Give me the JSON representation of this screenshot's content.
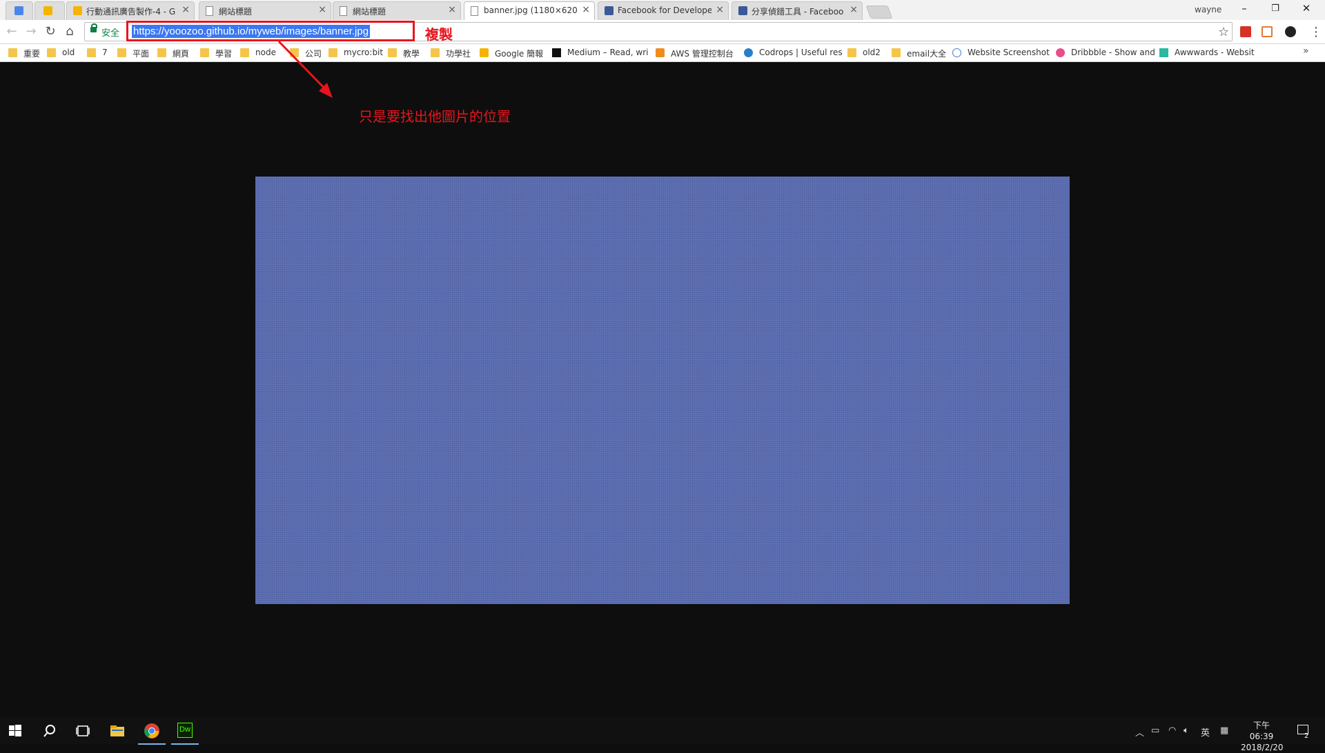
{
  "browser": {
    "tabs": [
      {
        "title": "",
        "icon": "google-docs-icon",
        "pinned": true
      },
      {
        "title": "",
        "icon": "google-slides-icon",
        "pinned": true
      },
      {
        "title": "行動通訊廣告製作-4 - G",
        "icon": "google-slides-icon"
      },
      {
        "title": "網站標題",
        "icon": "page-icon"
      },
      {
        "title": "網站標題",
        "icon": "page-icon"
      },
      {
        "title": "banner.jpg (1180×620)",
        "icon": "page-icon",
        "active": true
      },
      {
        "title": "Facebook for Develope",
        "icon": "facebook-icon"
      },
      {
        "title": "分享偵錯工具 - Faceboo",
        "icon": "facebook-icon"
      }
    ],
    "user": "wayne",
    "window_controls": {
      "minimize": "–",
      "restore": "❐",
      "close": "✕"
    },
    "secure_label": "安全",
    "url": "https://yooozoo.github.io/myweb/images/banner.jpg",
    "bookmarks": [
      {
        "label": "重要",
        "icon": "folder-icon"
      },
      {
        "label": "old",
        "icon": "folder-icon"
      },
      {
        "label": "7",
        "icon": "folder-icon"
      },
      {
        "label": "平面",
        "icon": "folder-icon"
      },
      {
        "label": "網頁",
        "icon": "folder-icon"
      },
      {
        "label": "學習",
        "icon": "folder-icon"
      },
      {
        "label": "node",
        "icon": "folder-icon"
      },
      {
        "label": "公司",
        "icon": "folder-icon"
      },
      {
        "label": "mycro:bit",
        "icon": "folder-icon"
      },
      {
        "label": "教學",
        "icon": "folder-icon"
      },
      {
        "label": "功學社",
        "icon": "folder-icon"
      },
      {
        "label": "Google 簡報",
        "icon": "google-slides-icon"
      },
      {
        "label": "Medium – Read, wri",
        "icon": "medium-icon"
      },
      {
        "label": "AWS 管理控制台",
        "icon": "aws-icon"
      },
      {
        "label": "Codrops | Useful res",
        "icon": "codrops-icon"
      },
      {
        "label": "old2",
        "icon": "folder-icon"
      },
      {
        "label": "email大全",
        "icon": "folder-icon"
      },
      {
        "label": "Website Screenshot",
        "icon": "web-icon"
      },
      {
        "label": "Dribbble - Show and",
        "icon": "dribbble-icon"
      },
      {
        "label": "Awwwards - Websit",
        "icon": "awwwards-icon"
      }
    ],
    "bookmarks_more": "»"
  },
  "annotation": {
    "copy_label": "複製",
    "note": "只是要找出他圖片的位置",
    "color": "#e8141d"
  },
  "content": {
    "image_name": "banner.jpg",
    "image_color": "#5a6cb0"
  },
  "taskbar": {
    "icons": [
      "windows-start-icon",
      "search-icon",
      "task-view-icon",
      "file-explorer-icon",
      "chrome-icon",
      "dreamweaver-icon"
    ],
    "dreamweaver_label": "Dw",
    "input_lang": "英",
    "clock_time": "下午 06:39",
    "clock_date": "2018/2/20",
    "notification_count": "2"
  }
}
